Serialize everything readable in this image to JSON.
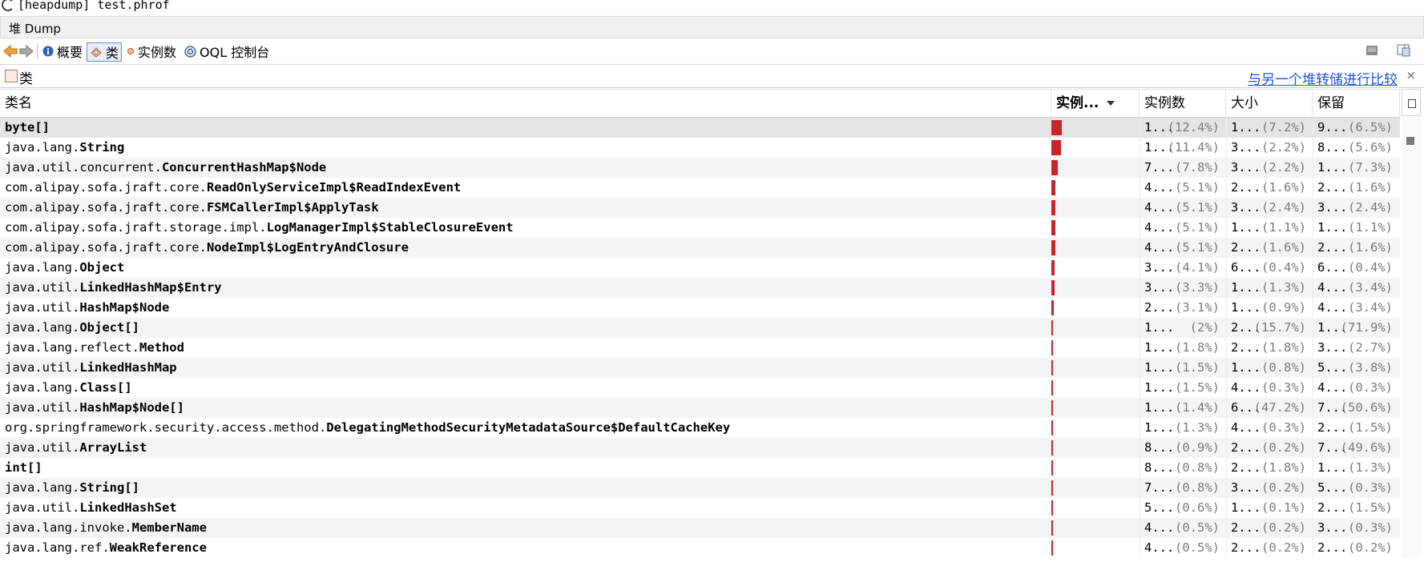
{
  "window": {
    "title": "[heapdump] test.phrof"
  },
  "heap_header": {
    "label": "堆 Dump"
  },
  "toolbar": {
    "summary": "概要",
    "classes": "类",
    "instances": "实例数",
    "oql": "OQL 控制台"
  },
  "section": {
    "title": "类",
    "compare_link": "与另一个堆转储进行比较",
    "close": "×"
  },
  "columns": {
    "name": "类名",
    "instances_bar": "实例...",
    "instances": "实例数",
    "size": "大小",
    "retained": "保留"
  },
  "rows": [
    {
      "pkg": "",
      "cls": "byte[]",
      "bar": 1.0,
      "inst": "1...",
      "inst_pct": "(12.4%)",
      "size": "1...",
      "size_pct": "(7.2%)",
      "ret": "9...",
      "ret_pct": "(6.5%)"
    },
    {
      "pkg": "java.lang.",
      "cls": "String",
      "bar": 0.92,
      "inst": "1...",
      "inst_pct": "(11.4%)",
      "size": "3...",
      "size_pct": "(2.2%)",
      "ret": "8...",
      "ret_pct": "(5.6%)"
    },
    {
      "pkg": "java.util.concurrent.",
      "cls": "ConcurrentHashMap$Node",
      "bar": 0.63,
      "inst": "7...",
      "inst_pct": "(7.8%)",
      "size": "3...",
      "size_pct": "(2.2%)",
      "ret": "1...",
      "ret_pct": "(7.3%)"
    },
    {
      "pkg": "com.alipay.sofa.jraft.core.",
      "cls": "ReadOnlyServiceImpl$ReadIndexEvent",
      "bar": 0.41,
      "inst": "4...",
      "inst_pct": "(5.1%)",
      "size": "2...",
      "size_pct": "(1.6%)",
      "ret": "2...",
      "ret_pct": "(1.6%)"
    },
    {
      "pkg": "com.alipay.sofa.jraft.core.",
      "cls": "FSMCallerImpl$ApplyTask",
      "bar": 0.41,
      "inst": "4...",
      "inst_pct": "(5.1%)",
      "size": "3...",
      "size_pct": "(2.4%)",
      "ret": "3...",
      "ret_pct": "(2.4%)"
    },
    {
      "pkg": "com.alipay.sofa.jraft.storage.impl.",
      "cls": "LogManagerImpl$StableClosureEvent",
      "bar": 0.41,
      "inst": "4...",
      "inst_pct": "(5.1%)",
      "size": "1...",
      "size_pct": "(1.1%)",
      "ret": "1...",
      "ret_pct": "(1.1%)"
    },
    {
      "pkg": "com.alipay.sofa.jraft.core.",
      "cls": "NodeImpl$LogEntryAndClosure",
      "bar": 0.41,
      "inst": "4...",
      "inst_pct": "(5.1%)",
      "size": "2...",
      "size_pct": "(1.6%)",
      "ret": "2...",
      "ret_pct": "(1.6%)"
    },
    {
      "pkg": "java.lang.",
      "cls": "Object",
      "bar": 0.33,
      "inst": "3...",
      "inst_pct": "(4.1%)",
      "size": "6...",
      "size_pct": "(0.4%)",
      "ret": "6...",
      "ret_pct": "(0.4%)"
    },
    {
      "pkg": "java.util.",
      "cls": "LinkedHashMap$Entry",
      "bar": 0.27,
      "inst": "3...",
      "inst_pct": "(3.3%)",
      "size": "1...",
      "size_pct": "(1.3%)",
      "ret": "4...",
      "ret_pct": "(3.4%)"
    },
    {
      "pkg": "java.util.",
      "cls": "HashMap$Node",
      "bar": 0.25,
      "inst": "2...",
      "inst_pct": "(3.1%)",
      "size": "1...",
      "size_pct": "(0.9%)",
      "ret": "4...",
      "ret_pct": "(3.4%)"
    },
    {
      "pkg": "java.lang.",
      "cls": "Object[]",
      "bar": 0.16,
      "inst": "1...",
      "inst_pct": "(2%)",
      "size": "2...",
      "size_pct": "(15.7%)",
      "ret": "1...",
      "ret_pct": "(71.9%)"
    },
    {
      "pkg": "java.lang.reflect.",
      "cls": "Method",
      "bar": 0.15,
      "inst": "1...",
      "inst_pct": "(1.8%)",
      "size": "2...",
      "size_pct": "(1.8%)",
      "ret": "3...",
      "ret_pct": "(2.7%)"
    },
    {
      "pkg": "java.util.",
      "cls": "LinkedHashMap",
      "bar": 0.12,
      "inst": "1...",
      "inst_pct": "(1.5%)",
      "size": "1...",
      "size_pct": "(0.8%)",
      "ret": "5...",
      "ret_pct": "(3.8%)"
    },
    {
      "pkg": "java.lang.",
      "cls": "Class[]",
      "bar": 0.12,
      "inst": "1...",
      "inst_pct": "(1.5%)",
      "size": "4...",
      "size_pct": "(0.3%)",
      "ret": "4...",
      "ret_pct": "(0.3%)"
    },
    {
      "pkg": "java.util.",
      "cls": "HashMap$Node[]",
      "bar": 0.11,
      "inst": "1...",
      "inst_pct": "(1.4%)",
      "size": "6...",
      "size_pct": "(47.2%)",
      "ret": "7...",
      "ret_pct": "(50.6%)"
    },
    {
      "pkg": "org.springframework.security.access.method.",
      "cls": "DelegatingMethodSecurityMetadataSource$DefaultCacheKey",
      "bar": 0.1,
      "inst": "1...",
      "inst_pct": "(1.3%)",
      "size": "4...",
      "size_pct": "(0.3%)",
      "ret": "2...",
      "ret_pct": "(1.5%)"
    },
    {
      "pkg": "java.util.",
      "cls": "ArrayList",
      "bar": 0.07,
      "inst": "8...",
      "inst_pct": "(0.9%)",
      "size": "2...",
      "size_pct": "(0.2%)",
      "ret": "7...",
      "ret_pct": "(49.6%)"
    },
    {
      "pkg": "",
      "cls": "int[]",
      "bar": 0.06,
      "inst": "8...",
      "inst_pct": "(0.8%)",
      "size": "2...",
      "size_pct": "(1.8%)",
      "ret": "1...",
      "ret_pct": "(1.3%)"
    },
    {
      "pkg": "java.lang.",
      "cls": "String[]",
      "bar": 0.06,
      "inst": "7...",
      "inst_pct": "(0.8%)",
      "size": "3...",
      "size_pct": "(0.2%)",
      "ret": "5...",
      "ret_pct": "(0.3%)"
    },
    {
      "pkg": "java.util.",
      "cls": "LinkedHashSet",
      "bar": 0.05,
      "inst": "5...",
      "inst_pct": "(0.6%)",
      "size": "1...",
      "size_pct": "(0.1%)",
      "ret": "2...",
      "ret_pct": "(1.5%)"
    },
    {
      "pkg": "java.lang.invoke.",
      "cls": "MemberName",
      "bar": 0.04,
      "inst": "4...",
      "inst_pct": "(0.5%)",
      "size": "2...",
      "size_pct": "(0.2%)",
      "ret": "3...",
      "ret_pct": "(0.3%)"
    },
    {
      "pkg": "java.lang.ref.",
      "cls": "WeakReference",
      "bar": 0.04,
      "inst": "4...",
      "inst_pct": "(0.5%)",
      "size": "2...",
      "size_pct": "(0.2%)",
      "ret": "2...",
      "ret_pct": "(0.2%)"
    }
  ],
  "colors": {
    "bar": "#c8242b",
    "link": "#2255cc"
  }
}
